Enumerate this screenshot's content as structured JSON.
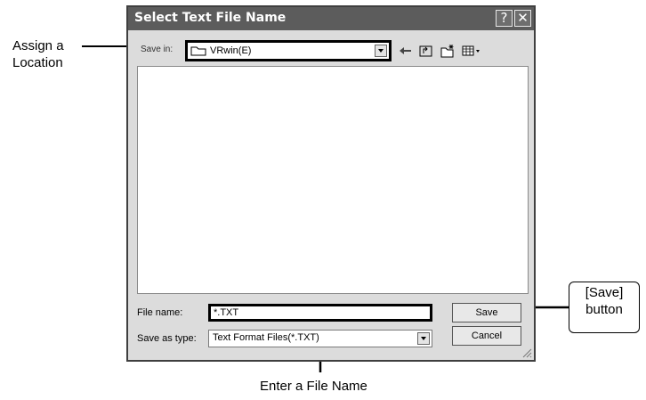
{
  "dialog": {
    "title": "Select Text File Name",
    "help_button": "?",
    "close_button": "✕",
    "save_in": {
      "label": "Save in:",
      "value": "VRwin(E)"
    },
    "toolbar": [
      "back-arrow-icon",
      "up-folder-icon",
      "new-folder-icon",
      "view-menu-icon"
    ],
    "file_name": {
      "label": "File name:",
      "value": "*.TXT"
    },
    "save_as_type": {
      "label": "Save as type:",
      "value": "Text Format Files(*.TXT)"
    },
    "buttons": {
      "save": "Save",
      "cancel": "Cancel"
    }
  },
  "callouts": {
    "assign_location_line1": "Assign a",
    "assign_location_line2": "Location",
    "enter_file_name": "Enter a File Name",
    "save_button_line1": "[Save]",
    "save_button_line2": "button"
  }
}
